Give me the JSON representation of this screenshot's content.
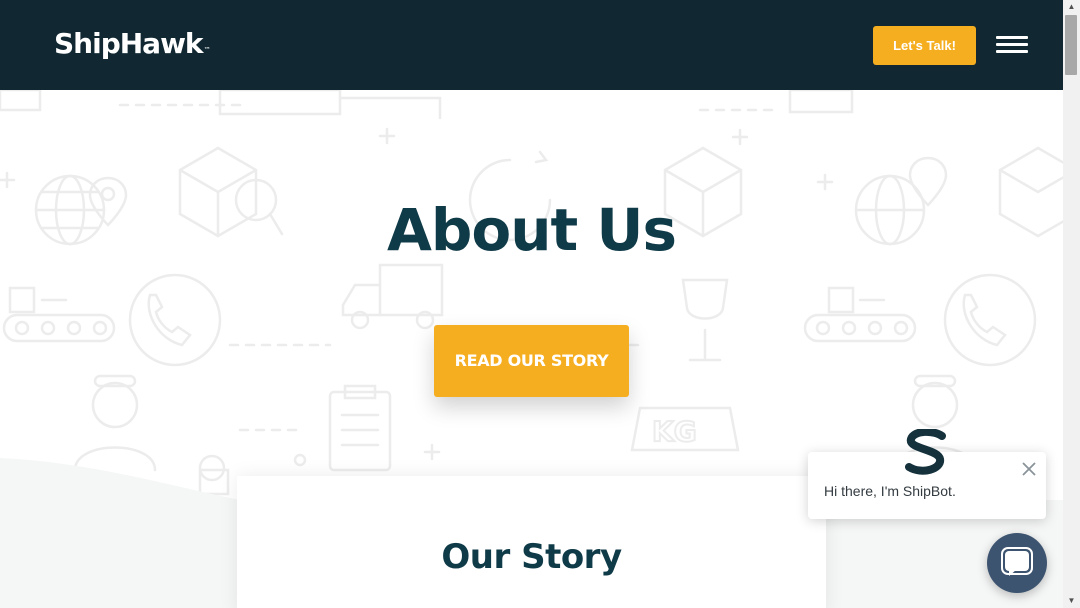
{
  "header": {
    "logo": "ShipHawk",
    "logo_tm": "™",
    "cta_label": "Let's Talk!"
  },
  "hero": {
    "title": "About Us",
    "button_label": "READ OUR STORY"
  },
  "story_card": {
    "title": "Our Story"
  },
  "chat": {
    "greeting": "Hi there, I'm ShipBot."
  },
  "colors": {
    "header_bg": "#112833",
    "accent": "#f6ae21",
    "heading": "#0f3a47",
    "chat_launcher": "#3d5470"
  },
  "icons": [
    "menu-icon",
    "close-icon",
    "chat-icon",
    "shipbot-avatar-icon",
    "scroll-up-arrow-icon",
    "scroll-down-arrow-icon"
  ]
}
